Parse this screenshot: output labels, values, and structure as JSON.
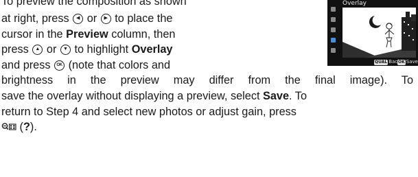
{
  "text": {
    "l1": "To preview the composition as shown",
    "l2": {
      "a": "at right, press",
      "b": "or",
      "c": "to place the"
    },
    "l3": {
      "a": "cursor in the",
      "b": "Preview",
      "c": "column, then"
    },
    "l4": {
      "a": "press",
      "b": "or",
      "c": "to highlight",
      "d": "Overlay"
    },
    "l5": {
      "a": "and press",
      "b": "(note that colors and"
    },
    "l6": "brightness in the preview may differ from the final image).  To",
    "l7": {
      "a": "save the overlay without displaying a preview, select",
      "b": "Save",
      "c": ".  To"
    },
    "l8": "return to Step 4 and select new photos or adjust gain, press",
    "l9": {
      "b": "(",
      "c": "?",
      "d": ")."
    }
  },
  "icons": {
    "left": "multi-selector-left-icon",
    "right": "multi-selector-right-icon",
    "up": "multi-selector-up-icon",
    "down": "multi-selector-down-icon",
    "ok": "ok-button-icon",
    "zoom_out": "zoom-out-thumbnail-icon"
  },
  "screen": {
    "title": "Overlay",
    "back_key": "QUAL",
    "back_label": "Back",
    "save_key": "OK",
    "save_label": "Save"
  },
  "colors": {
    "text": "#1a1a1a",
    "screen_bg": "#111111",
    "preview_bg": "#ffffff",
    "menu_active": "#4a8fd4"
  }
}
